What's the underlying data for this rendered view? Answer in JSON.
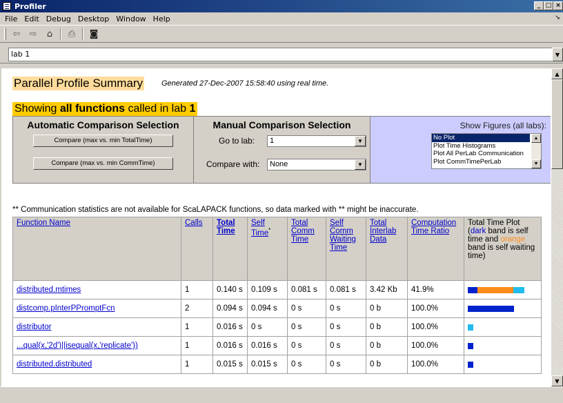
{
  "window": {
    "title": "Profiler"
  },
  "menu": [
    "File",
    "Edit",
    "Debug",
    "Desktop",
    "Window",
    "Help"
  ],
  "toolbar": {
    "icons": [
      "back-arrow-icon",
      "forward-arrow-icon",
      "home-icon",
      "print-icon",
      "find-icon"
    ]
  },
  "lab_selector": {
    "value": "lab 1"
  },
  "summary": {
    "title": "Parallel Profile Summary",
    "generated": "Generated 27-Dec-2007 15:58:40 using real time."
  },
  "showing": {
    "prefix": "Showing ",
    "strong1": "all functions",
    "middle": " called in lab ",
    "strong2": "1"
  },
  "auto_comparison": {
    "heading": "Automatic Comparison Selection",
    "button1": "Compare (max vs. min TotalTime)",
    "button2": "Compare (max vs. min CommTime)"
  },
  "manual_comparison": {
    "heading": "Manual Comparison Selection",
    "goto_label": "Go to lab:",
    "goto_value": "1",
    "compare_label": "Compare with:",
    "compare_value": "None"
  },
  "figures": {
    "heading": "Show Figures (all labs):",
    "options": [
      "No Plot",
      "Plot Time Histograms",
      "Plot All PerLab Communication",
      "Plot CommTimePerLab"
    ],
    "selected_index": 0
  },
  "note": "** Communication statistics are not available for ScaLAPACK functions, so data marked with ** might be inaccurate.",
  "table": {
    "headers": {
      "function_name": "Function Name",
      "calls": "Calls",
      "total_time": "Total Time",
      "self_time": "Self Time",
      "self_time_mark": "*",
      "total_comm_time": "Total Comm Time",
      "self_comm_waiting_time": "Self Comm Waiting Time",
      "total_interlab_data": "Total Interlab Data",
      "computation_time_ratio": "Computation Time Ratio",
      "plot_head": "Total Time Plot (",
      "plot_dark": "dark",
      "plot_mid": " band is self time and ",
      "plot_orange": "orange",
      "plot_tail": " band is self waiting time)"
    },
    "rows": [
      {
        "name": "distributed.mtimes",
        "calls": "1",
        "total": "0.140 s",
        "self": "0.109 s",
        "comm": "0.081 s",
        "wait": "0.081 s",
        "data": "3.42 Kb",
        "ratio": "41.9%",
        "bar": {
          "dark": 0.14,
          "orange": 0.52,
          "cyan": 0.16
        }
      },
      {
        "name": "distcomp.pInterPPromptFcn",
        "calls": "2",
        "total": "0.094 s",
        "self": "0.094 s",
        "comm": "0 s",
        "wait": "0 s",
        "data": "0 b",
        "ratio": "100.0%",
        "bar": {
          "dark": 0.67,
          "orange": 0,
          "cyan": 0
        }
      },
      {
        "name": "distributor",
        "calls": "1",
        "total": "0.016 s",
        "self": "0 s",
        "comm": "0 s",
        "wait": "0 s",
        "data": "0 b",
        "ratio": "100.0%",
        "bar": {
          "dark": 0,
          "orange": 0,
          "cyan": 0.08
        }
      },
      {
        "name": "...qual(x,'2d')||isequal(x,'replicate'))",
        "calls": "1",
        "total": "0.016 s",
        "self": "0.016 s",
        "comm": "0 s",
        "wait": "0 s",
        "data": "0 b",
        "ratio": "100.0%",
        "bar": {
          "dark": 0.08,
          "orange": 0,
          "cyan": 0
        }
      },
      {
        "name": "distributed.distributed",
        "calls": "1",
        "total": "0.015 s",
        "self": "0.015 s",
        "comm": "0 s",
        "wait": "0 s",
        "data": "0 b",
        "ratio": "100.0%",
        "bar": {
          "dark": 0.08,
          "orange": 0,
          "cyan": 0
        }
      }
    ]
  },
  "colors": {
    "dark_band": "#0022cc",
    "orange_band": "#ff8c1a",
    "cyan_band": "#22bbee",
    "title_highlight": "#ffdc9b",
    "showing_highlight": "#ffcc00",
    "figures_bg": "#ccccff"
  }
}
